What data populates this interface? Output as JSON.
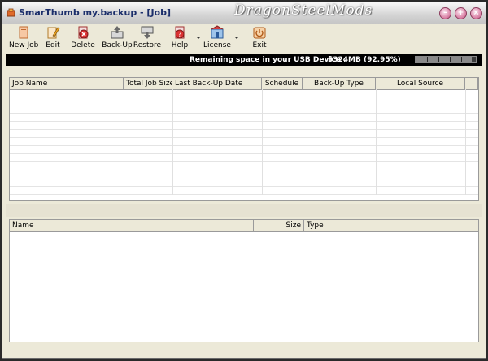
{
  "window": {
    "title": "SmarThumb my.backup - [Job]",
    "watermark": "DragonSteelMods"
  },
  "window_controls": {
    "minimize": "–",
    "maximize": "+",
    "close": "×"
  },
  "toolbar": {
    "items": [
      {
        "label": "New Job",
        "icon": "new-job-icon"
      },
      {
        "label": "Edit",
        "icon": "pencil-icon"
      },
      {
        "label": "Delete",
        "icon": "delete-icon"
      },
      {
        "label": "Back-Up",
        "icon": "backup-icon"
      },
      {
        "label": "Restore",
        "icon": "restore-icon"
      },
      {
        "label": "Help",
        "icon": "help-icon"
      },
      {
        "label": "License",
        "icon": "license-icon"
      },
      {
        "label": "Exit",
        "icon": "exit-icon"
      }
    ]
  },
  "status": {
    "label": "Remaining space in your USB Device :",
    "value": "5324MB (92.95%)",
    "remaining_fraction": 0.9295
  },
  "jobs_table": {
    "columns": [
      "Job Name",
      "Total Job Size",
      "Last Back-Up Date",
      "Schedule",
      "Back-Up Type",
      "Local Source"
    ],
    "rows": []
  },
  "files_table": {
    "columns": [
      "Name",
      "Size",
      "Type"
    ],
    "rows": []
  },
  "colors": {
    "title_text": "#1b2e6b",
    "status_bg": "#000000",
    "window_bg": "#ece9d8"
  }
}
